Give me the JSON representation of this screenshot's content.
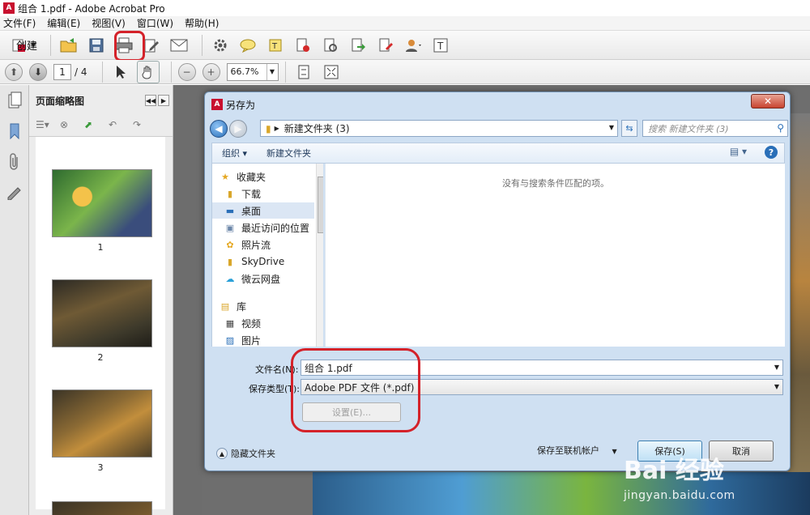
{
  "app": {
    "title": "组合 1.pdf - Adobe Acrobat Pro"
  },
  "menu": [
    "文件(F)",
    "编辑(E)",
    "视图(V)",
    "窗口(W)",
    "帮助(H)"
  ],
  "toolbar": {
    "create_label": "创建"
  },
  "nav": {
    "page_current": "1",
    "page_total": "/ 4",
    "zoom": "66.7%"
  },
  "thumbnails": {
    "title": "页面缩略图",
    "labels": [
      "1",
      "2",
      "3"
    ]
  },
  "dialog": {
    "title": "另存为",
    "address": "新建文件夹 (3)",
    "search_placeholder": "搜索 新建文件夹 (3)",
    "organize": "组织 ▾",
    "new_folder": "新建文件夹",
    "empty_message": "没有与搜索条件匹配的项。",
    "nav_items": [
      {
        "label": "收藏夹",
        "icon": "star-icon"
      },
      {
        "label": "下载",
        "icon": "download-folder-icon"
      },
      {
        "label": "桌面",
        "icon": "desktop-icon"
      },
      {
        "label": "最近访问的位置",
        "icon": "recent-places-icon"
      },
      {
        "label": "照片流",
        "icon": "photo-stream-icon"
      },
      {
        "label": "SkyDrive",
        "icon": "skydrive-icon"
      },
      {
        "label": "微云网盘",
        "icon": "weiyun-icon"
      },
      {
        "label": "库",
        "icon": "library-icon"
      },
      {
        "label": "视频",
        "icon": "video-icon"
      },
      {
        "label": "图片",
        "icon": "picture-icon"
      }
    ],
    "filename_label": "文件名(N):",
    "filename_value": "组合 1.pdf",
    "filetype_label": "保存类型(T):",
    "filetype_value": "Adobe PDF 文件 (*.pdf)",
    "settings_button": "设置(E)...",
    "hide_folders": "隐藏文件夹",
    "save_online": "保存至联机帐户",
    "save_button": "保存(S)",
    "cancel_button": "取消"
  },
  "watermark": {
    "line1": "Bai 经验",
    "line2": "jingyan.baidu.com"
  },
  "colors": {
    "highlight": "#d4222a",
    "dialog_bg": "#cfe0f2"
  }
}
